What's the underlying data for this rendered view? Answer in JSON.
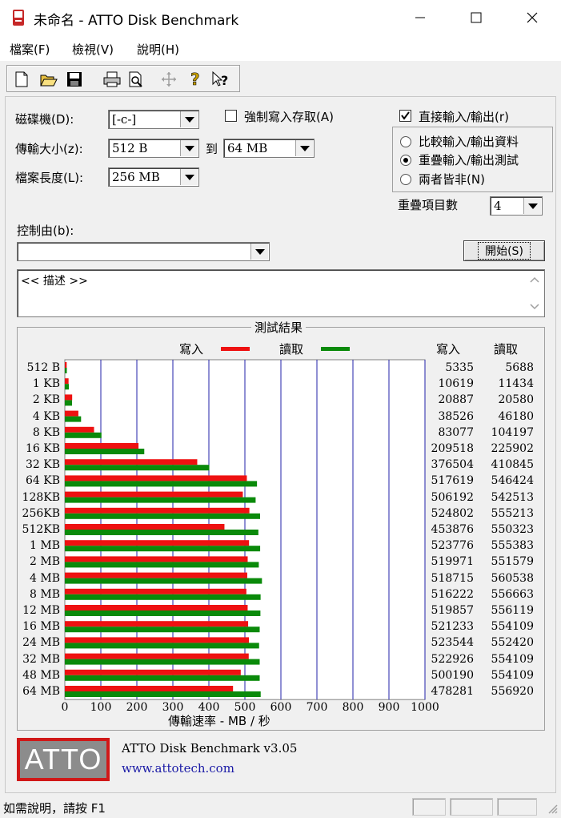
{
  "window": {
    "title": "未命名 - ATTO Disk Benchmark",
    "controls": {
      "minimize": "—",
      "maximize": "☐",
      "close": "✕"
    }
  },
  "menu": [
    "檔案(F)",
    "檢視(V)",
    "說明(H)"
  ],
  "toolbar": {
    "icons": [
      "new-icon",
      "open-icon",
      "save-icon",
      "print-icon",
      "print-preview-icon",
      "move-icon",
      "help-icon",
      "context-help-icon"
    ]
  },
  "settings": {
    "drive_label": "磁碟機(D):",
    "drive_value": "[-c-]",
    "transfer_label": "傳輸大小(z):",
    "transfer_from": "512 B",
    "to_label": "到",
    "transfer_to": "64 MB",
    "length_label": "檔案長度(L):",
    "length_value": "256 MB",
    "force_write_label": "強制寫入存取(A)",
    "force_write_checked": false,
    "direct_io_label": "直接輸入/輸出(r)",
    "direct_io_checked": true,
    "radio_options": [
      "比較輸入/輸出資料",
      "重疊輸入/輸出測試",
      "兩者皆非(N)"
    ],
    "radio_selected": 1,
    "queue_label": "重疊項目數",
    "queue_value": "4",
    "controlled_label": "控制由(b):",
    "controlled_value": "",
    "start_button": "開始(S)"
  },
  "description": "<< 描述 >>",
  "results": {
    "title": "測試結果",
    "legend_write": "寫入",
    "legend_read": "讀取",
    "col_write": "寫入",
    "col_read": "讀取",
    "xlabel": "傳輸速率 - MB / 秒"
  },
  "chart_data": {
    "type": "bar",
    "orientation": "horizontal",
    "title": "測試結果",
    "xlabel": "傳輸速率 - MB / 秒",
    "xlim": [
      0,
      1000
    ],
    "xticks": [
      "0",
      "100",
      "200",
      "300",
      "400",
      "500",
      "600",
      "700",
      "800",
      "900",
      "1000"
    ],
    "grid": true,
    "categories": [
      "512 B",
      "1 KB",
      "2 KB",
      "4 KB",
      "8 KB",
      "16 KB",
      "32 KB",
      "64 KB",
      "128KB",
      "256KB",
      "512KB",
      "1 MB",
      "2 MB",
      "4 MB",
      "8 MB",
      "12 MB",
      "16 MB",
      "24 MB",
      "32 MB",
      "48 MB",
      "64 MB"
    ],
    "series": [
      {
        "name": "寫入",
        "color": "#ee1111",
        "values": [
          5335,
          10619,
          20887,
          38526,
          83077,
          209518,
          376504,
          517619,
          506192,
          524802,
          453876,
          523776,
          519971,
          518715,
          516222,
          519857,
          521233,
          523544,
          522926,
          500190,
          478281
        ],
        "value_labels": [
          "5335",
          "10619",
          "20887",
          "38526",
          "83077",
          "209518",
          "376504",
          "517619",
          "506192",
          "524802",
          "453876",
          "523776",
          "519971",
          "518715",
          "516222",
          "519857",
          "521233",
          "523544",
          "522926",
          "500190",
          "478281"
        ]
      },
      {
        "name": "讀取",
        "color": "#0a8a0a",
        "values": [
          5688,
          11434,
          20580,
          46180,
          104197,
          225902,
          410845,
          546424,
          542513,
          555213,
          550323,
          555383,
          551579,
          560538,
          556663,
          556119,
          554109,
          552420,
          554109,
          554109,
          556920
        ],
        "value_labels": [
          "5688",
          "11434",
          "20580",
          "46180",
          "104197",
          "225902",
          "410845",
          "546424",
          "542513",
          "555213",
          "550323",
          "555383",
          "551579",
          "560538",
          "556663",
          "556119",
          "554109",
          "552420",
          "554109",
          "554109",
          "556920"
        ]
      }
    ]
  },
  "footer": {
    "logo_text": "ATTO",
    "product": "ATTO Disk Benchmark v3.05",
    "url": "www.attotech.com"
  },
  "status": {
    "text": "如需說明，請按 F1"
  }
}
